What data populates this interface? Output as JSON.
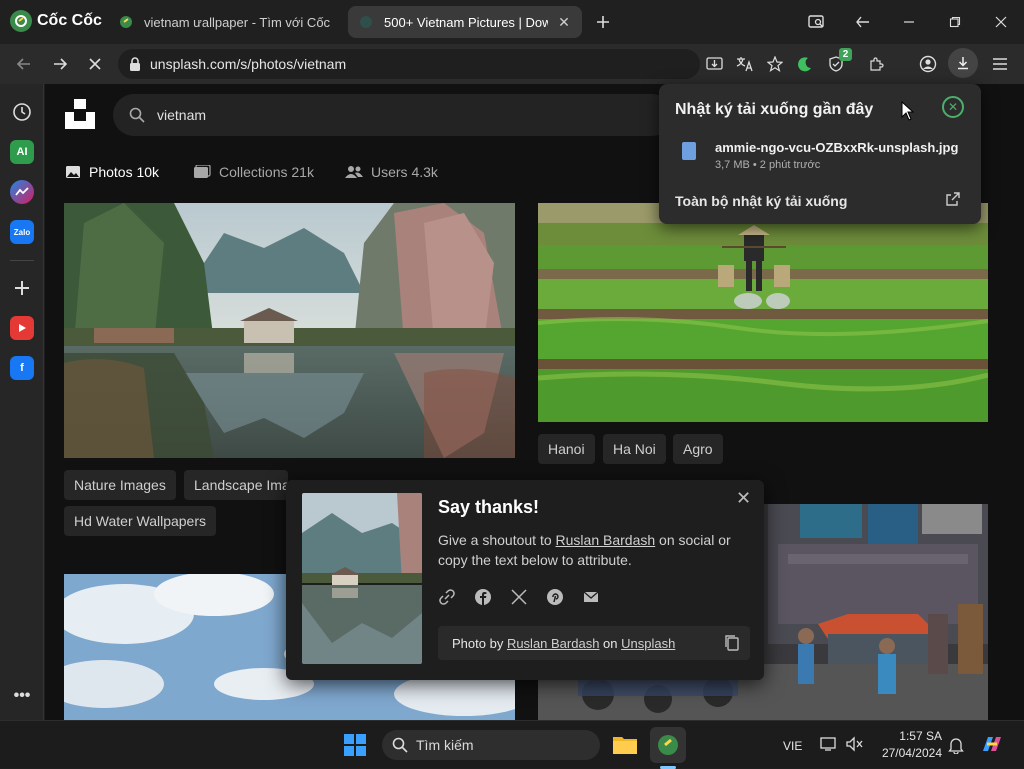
{
  "browser": {
    "brand": "Cốc Cốc",
    "tabs": [
      {
        "title": "vietnam ưallpaper - Tìm với Cốc C"
      },
      {
        "title": "500+ Vietnam Pictures | Dow"
      }
    ],
    "url": "unsplash.com/s/photos/vietnam",
    "shield_badge": "2"
  },
  "search": {
    "query": "vietnam"
  },
  "filters": [
    {
      "label": "Photos 10k"
    },
    {
      "label": "Collections 21k"
    },
    {
      "label": "Users 4.3k"
    }
  ],
  "tags": {
    "left_1": "Nature Images",
    "left_2": "Landscape Ima",
    "left_3": "Hd Water Wallpapers",
    "right_1": "Hanoi",
    "right_2": "Ha Noi",
    "right_3": "Agro"
  },
  "downloads": {
    "title": "Nhật ký tải xuống gần đây",
    "filename": "ammie-ngo-vcu-OZBxxRk-unsplash.jpg",
    "meta": "3,7 MB • 2 phút trước",
    "all_label": "Toàn bộ nhật ký tải xuống"
  },
  "thanks": {
    "title": "Say thanks!",
    "text_before": "Give a shoutout to ",
    "author": "Ruslan Bardash",
    "text_after": " on social or copy the text below to attribute.",
    "photo_by": "Photo by ",
    "on": " on ",
    "site": "Unsplash"
  },
  "taskbar": {
    "search_placeholder": "Tìm kiếm",
    "language": "VIE",
    "time": "1:57 SA",
    "date": "27/04/2024"
  },
  "colors": {
    "accent_green": "#4caf6a",
    "page_bg": "#111111"
  }
}
